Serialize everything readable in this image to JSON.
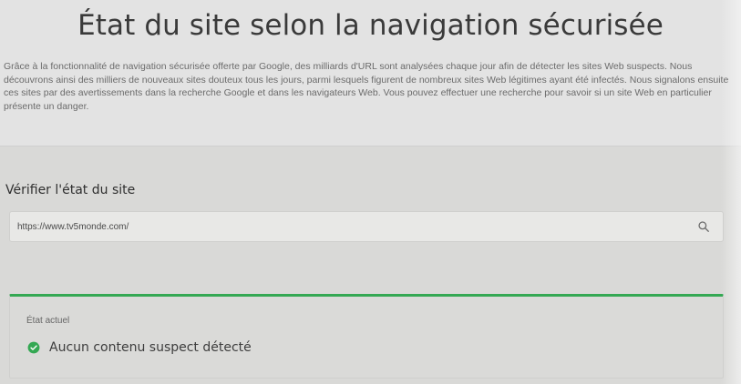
{
  "page": {
    "title": "État du site selon la navigation sécurisée",
    "intro": "Grâce à la fonctionnalité de navigation sécurisée offerte par Google, des milliards d'URL sont analysées chaque jour afin de détecter les sites Web suspects. Nous découvrons ainsi des milliers de nouveaux sites douteux tous les jours, parmi lesquels figurent de nombreux sites Web légitimes ayant été infectés. Nous signalons ensuite ces sites par des avertissements dans la recherche Google et dans les navigateurs Web. Vous pouvez effectuer une recherche pour savoir si un site Web en particulier présente un danger."
  },
  "check": {
    "title": "Vérifier l'état du site",
    "value": "https://www.tv5monde.com/",
    "icon": "search-icon"
  },
  "status": {
    "label": "État actuel",
    "value": "Aucun contenu suspect détecté",
    "icon": "check-circle-icon",
    "color": "#34a853"
  },
  "colors": {
    "accent": "#34a853"
  }
}
